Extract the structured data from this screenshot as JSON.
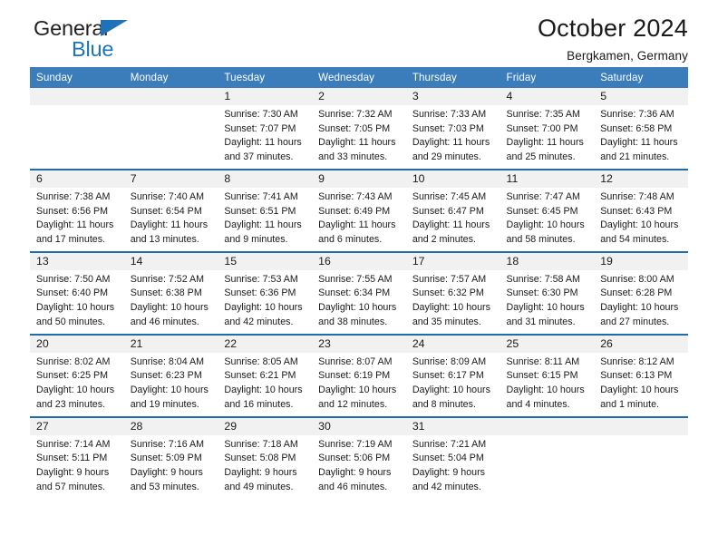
{
  "brand": {
    "name_top": "General",
    "name_bottom": "Blue",
    "triangle_color": "#1f72b8",
    "text_color": "#231f20"
  },
  "header": {
    "title": "October 2024",
    "subtitle": "Bergkamen, Germany"
  },
  "theme": {
    "header_bg": "#3a7dba",
    "week_separator": "#1f6cad",
    "daynum_bg": "#f1f1f1",
    "cell_bg": "#ffffff"
  },
  "weekday_headers": [
    "Sunday",
    "Monday",
    "Tuesday",
    "Wednesday",
    "Thursday",
    "Friday",
    "Saturday"
  ],
  "weeks": [
    {
      "days": [
        {
          "num": "",
          "sunrise": "",
          "sunset": "",
          "daylight1": "",
          "daylight2": "",
          "empty": true
        },
        {
          "num": "",
          "sunrise": "",
          "sunset": "",
          "daylight1": "",
          "daylight2": "",
          "empty": true
        },
        {
          "num": "1",
          "sunrise": "Sunrise: 7:30 AM",
          "sunset": "Sunset: 7:07 PM",
          "daylight1": "Daylight: 11 hours",
          "daylight2": "and 37 minutes.",
          "empty": false
        },
        {
          "num": "2",
          "sunrise": "Sunrise: 7:32 AM",
          "sunset": "Sunset: 7:05 PM",
          "daylight1": "Daylight: 11 hours",
          "daylight2": "and 33 minutes.",
          "empty": false
        },
        {
          "num": "3",
          "sunrise": "Sunrise: 7:33 AM",
          "sunset": "Sunset: 7:03 PM",
          "daylight1": "Daylight: 11 hours",
          "daylight2": "and 29 minutes.",
          "empty": false
        },
        {
          "num": "4",
          "sunrise": "Sunrise: 7:35 AM",
          "sunset": "Sunset: 7:00 PM",
          "daylight1": "Daylight: 11 hours",
          "daylight2": "and 25 minutes.",
          "empty": false
        },
        {
          "num": "5",
          "sunrise": "Sunrise: 7:36 AM",
          "sunset": "Sunset: 6:58 PM",
          "daylight1": "Daylight: 11 hours",
          "daylight2": "and 21 minutes.",
          "empty": false
        }
      ]
    },
    {
      "days": [
        {
          "num": "6",
          "sunrise": "Sunrise: 7:38 AM",
          "sunset": "Sunset: 6:56 PM",
          "daylight1": "Daylight: 11 hours",
          "daylight2": "and 17 minutes.",
          "empty": false
        },
        {
          "num": "7",
          "sunrise": "Sunrise: 7:40 AM",
          "sunset": "Sunset: 6:54 PM",
          "daylight1": "Daylight: 11 hours",
          "daylight2": "and 13 minutes.",
          "empty": false
        },
        {
          "num": "8",
          "sunrise": "Sunrise: 7:41 AM",
          "sunset": "Sunset: 6:51 PM",
          "daylight1": "Daylight: 11 hours",
          "daylight2": "and 9 minutes.",
          "empty": false
        },
        {
          "num": "9",
          "sunrise": "Sunrise: 7:43 AM",
          "sunset": "Sunset: 6:49 PM",
          "daylight1": "Daylight: 11 hours",
          "daylight2": "and 6 minutes.",
          "empty": false
        },
        {
          "num": "10",
          "sunrise": "Sunrise: 7:45 AM",
          "sunset": "Sunset: 6:47 PM",
          "daylight1": "Daylight: 11 hours",
          "daylight2": "and 2 minutes.",
          "empty": false
        },
        {
          "num": "11",
          "sunrise": "Sunrise: 7:47 AM",
          "sunset": "Sunset: 6:45 PM",
          "daylight1": "Daylight: 10 hours",
          "daylight2": "and 58 minutes.",
          "empty": false
        },
        {
          "num": "12",
          "sunrise": "Sunrise: 7:48 AM",
          "sunset": "Sunset: 6:43 PM",
          "daylight1": "Daylight: 10 hours",
          "daylight2": "and 54 minutes.",
          "empty": false
        }
      ]
    },
    {
      "days": [
        {
          "num": "13",
          "sunrise": "Sunrise: 7:50 AM",
          "sunset": "Sunset: 6:40 PM",
          "daylight1": "Daylight: 10 hours",
          "daylight2": "and 50 minutes.",
          "empty": false
        },
        {
          "num": "14",
          "sunrise": "Sunrise: 7:52 AM",
          "sunset": "Sunset: 6:38 PM",
          "daylight1": "Daylight: 10 hours",
          "daylight2": "and 46 minutes.",
          "empty": false
        },
        {
          "num": "15",
          "sunrise": "Sunrise: 7:53 AM",
          "sunset": "Sunset: 6:36 PM",
          "daylight1": "Daylight: 10 hours",
          "daylight2": "and 42 minutes.",
          "empty": false
        },
        {
          "num": "16",
          "sunrise": "Sunrise: 7:55 AM",
          "sunset": "Sunset: 6:34 PM",
          "daylight1": "Daylight: 10 hours",
          "daylight2": "and 38 minutes.",
          "empty": false
        },
        {
          "num": "17",
          "sunrise": "Sunrise: 7:57 AM",
          "sunset": "Sunset: 6:32 PM",
          "daylight1": "Daylight: 10 hours",
          "daylight2": "and 35 minutes.",
          "empty": false
        },
        {
          "num": "18",
          "sunrise": "Sunrise: 7:58 AM",
          "sunset": "Sunset: 6:30 PM",
          "daylight1": "Daylight: 10 hours",
          "daylight2": "and 31 minutes.",
          "empty": false
        },
        {
          "num": "19",
          "sunrise": "Sunrise: 8:00 AM",
          "sunset": "Sunset: 6:28 PM",
          "daylight1": "Daylight: 10 hours",
          "daylight2": "and 27 minutes.",
          "empty": false
        }
      ]
    },
    {
      "days": [
        {
          "num": "20",
          "sunrise": "Sunrise: 8:02 AM",
          "sunset": "Sunset: 6:25 PM",
          "daylight1": "Daylight: 10 hours",
          "daylight2": "and 23 minutes.",
          "empty": false
        },
        {
          "num": "21",
          "sunrise": "Sunrise: 8:04 AM",
          "sunset": "Sunset: 6:23 PM",
          "daylight1": "Daylight: 10 hours",
          "daylight2": "and 19 minutes.",
          "empty": false
        },
        {
          "num": "22",
          "sunrise": "Sunrise: 8:05 AM",
          "sunset": "Sunset: 6:21 PM",
          "daylight1": "Daylight: 10 hours",
          "daylight2": "and 16 minutes.",
          "empty": false
        },
        {
          "num": "23",
          "sunrise": "Sunrise: 8:07 AM",
          "sunset": "Sunset: 6:19 PM",
          "daylight1": "Daylight: 10 hours",
          "daylight2": "and 12 minutes.",
          "empty": false
        },
        {
          "num": "24",
          "sunrise": "Sunrise: 8:09 AM",
          "sunset": "Sunset: 6:17 PM",
          "daylight1": "Daylight: 10 hours",
          "daylight2": "and 8 minutes.",
          "empty": false
        },
        {
          "num": "25",
          "sunrise": "Sunrise: 8:11 AM",
          "sunset": "Sunset: 6:15 PM",
          "daylight1": "Daylight: 10 hours",
          "daylight2": "and 4 minutes.",
          "empty": false
        },
        {
          "num": "26",
          "sunrise": "Sunrise: 8:12 AM",
          "sunset": "Sunset: 6:13 PM",
          "daylight1": "Daylight: 10 hours",
          "daylight2": "and 1 minute.",
          "empty": false
        }
      ]
    },
    {
      "days": [
        {
          "num": "27",
          "sunrise": "Sunrise: 7:14 AM",
          "sunset": "Sunset: 5:11 PM",
          "daylight1": "Daylight: 9 hours",
          "daylight2": "and 57 minutes.",
          "empty": false
        },
        {
          "num": "28",
          "sunrise": "Sunrise: 7:16 AM",
          "sunset": "Sunset: 5:09 PM",
          "daylight1": "Daylight: 9 hours",
          "daylight2": "and 53 minutes.",
          "empty": false
        },
        {
          "num": "29",
          "sunrise": "Sunrise: 7:18 AM",
          "sunset": "Sunset: 5:08 PM",
          "daylight1": "Daylight: 9 hours",
          "daylight2": "and 49 minutes.",
          "empty": false
        },
        {
          "num": "30",
          "sunrise": "Sunrise: 7:19 AM",
          "sunset": "Sunset: 5:06 PM",
          "daylight1": "Daylight: 9 hours",
          "daylight2": "and 46 minutes.",
          "empty": false
        },
        {
          "num": "31",
          "sunrise": "Sunrise: 7:21 AM",
          "sunset": "Sunset: 5:04 PM",
          "daylight1": "Daylight: 9 hours",
          "daylight2": "and 42 minutes.",
          "empty": false
        },
        {
          "num": "",
          "sunrise": "",
          "sunset": "",
          "daylight1": "",
          "daylight2": "",
          "empty": true
        },
        {
          "num": "",
          "sunrise": "",
          "sunset": "",
          "daylight1": "",
          "daylight2": "",
          "empty": true
        }
      ]
    }
  ]
}
